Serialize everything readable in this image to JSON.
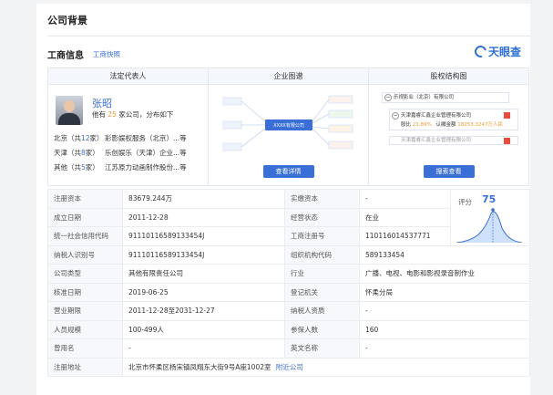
{
  "section_title": "公司背景",
  "business_info": "工商信息",
  "snapshot_link": "工商快照",
  "logo_text": "天眼查",
  "cards": {
    "legal_rep": {
      "header": "法定代表人",
      "name": "张昭",
      "count_prefix": "他有",
      "count": "25",
      "count_suffix": "家公司，分布如下",
      "rows": [
        {
          "region": "北京",
          "n": "12",
          "company": "彩影娱权服务（北京）...等"
        },
        {
          "region": "天津",
          "n": "8",
          "company": "乐创娱乐（天津）企业...等"
        },
        {
          "region": "其他",
          "n": "5",
          "company": "江苏原力动画制作股份...等"
        }
      ],
      "region_open": "（共",
      "region_close": "家）"
    },
    "enterprise_graph": {
      "header": "企业图谱",
      "center_label": "XXXX有限公司",
      "button": "查看详情"
    },
    "equity": {
      "header": "股权结构图",
      "top_company": "乐视影业（北京）有限公司",
      "child1_name": "天津嘉睿汇鑫企业管理有限公司",
      "child1_ratio_label": "股比",
      "child1_ratio": "21.89%",
      "child1_capital_label": "认缴金额",
      "child1_capital": "18253.3247万人民",
      "child2_name": "天津嘉睿汇鑫企业管理有限公司",
      "button": "搜索查看"
    }
  },
  "info_rows": [
    {
      "k1": "注册资本",
      "v1": "83679.244万",
      "k2": "实缴资本",
      "v2": "-"
    },
    {
      "k1": "成立日期",
      "v1": "2011-12-28",
      "k2": "经营状态",
      "v2": "在业"
    },
    {
      "k1": "统一社会信用代码",
      "v1": "91110116589133454J",
      "k2": "工商注册号",
      "v2": "110116014537771"
    },
    {
      "k1": "纳税人识别号",
      "v1": "91110116589133454J",
      "k2": "组织机构代码",
      "v2": "589133454"
    },
    {
      "k1": "公司类型",
      "v1": "其他有限责任公司",
      "k2": "行业",
      "v2": "广播、电视、电影和影视录音制作业"
    },
    {
      "k1": "核准日期",
      "v1": "2019-06-25",
      "k2": "登记机关",
      "v2": "怀柔分局"
    },
    {
      "k1": "营业期限",
      "v1": "2011-12-28至2031-12-27",
      "k2": "纳税人资质",
      "v2": "-"
    },
    {
      "k1": "人员规模",
      "v1": "100-499人",
      "k2": "参保人数",
      "v2": "160"
    },
    {
      "k1": "曾用名",
      "v1": "-",
      "k2": "英文名称",
      "v2": "-"
    }
  ],
  "address": {
    "k": "注册地址",
    "v": "北京市怀柔区杨宋镇凤翔东大街9号A座1002室",
    "near": "附近公司"
  },
  "score": {
    "label": "评分",
    "value": "75"
  },
  "colors": {
    "accent": "#3a6fd8",
    "orange": "#f29b2f",
    "red": "#e74c3c"
  }
}
